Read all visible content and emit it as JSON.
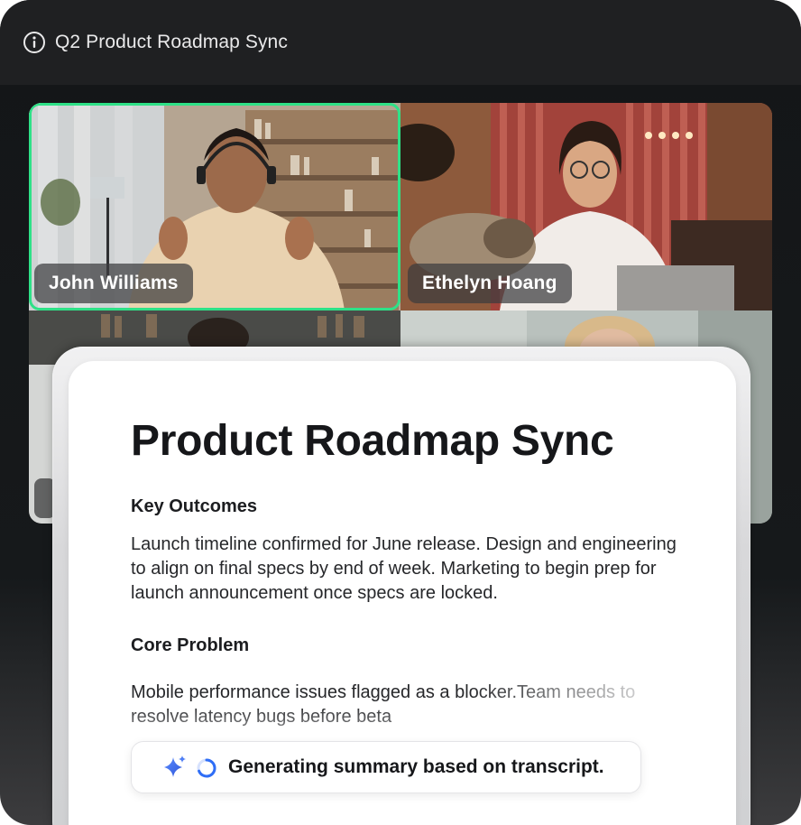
{
  "window": {
    "title": "Q2 Product Roadmap Sync"
  },
  "participants": [
    {
      "name": "John Williams",
      "active_speaker": true
    },
    {
      "name": "Ethelyn Hoang",
      "active_speaker": false
    }
  ],
  "summary": {
    "title": "Product Roadmap Sync",
    "sections": [
      {
        "heading": "Key Outcomes",
        "body": "Launch timeline confirmed for June release. Design and engineering to align on final specs by end of week. Marketing to begin prep for launch announcement once specs are locked."
      },
      {
        "heading": "Core Problem",
        "body": "Mobile performance issues flagged as a blocker.Team needs to resolve latency bugs before beta"
      }
    ],
    "status": "Generating summary based on transcript."
  },
  "icons": {
    "info": "info-icon",
    "sparkle": "sparkle-icon",
    "spinner": "spinner-icon"
  },
  "colors": {
    "active_speaker_border": "#2ee187",
    "spinner_blue": "#2f6ef6",
    "sparkle_blue": "#3d6ff2"
  }
}
